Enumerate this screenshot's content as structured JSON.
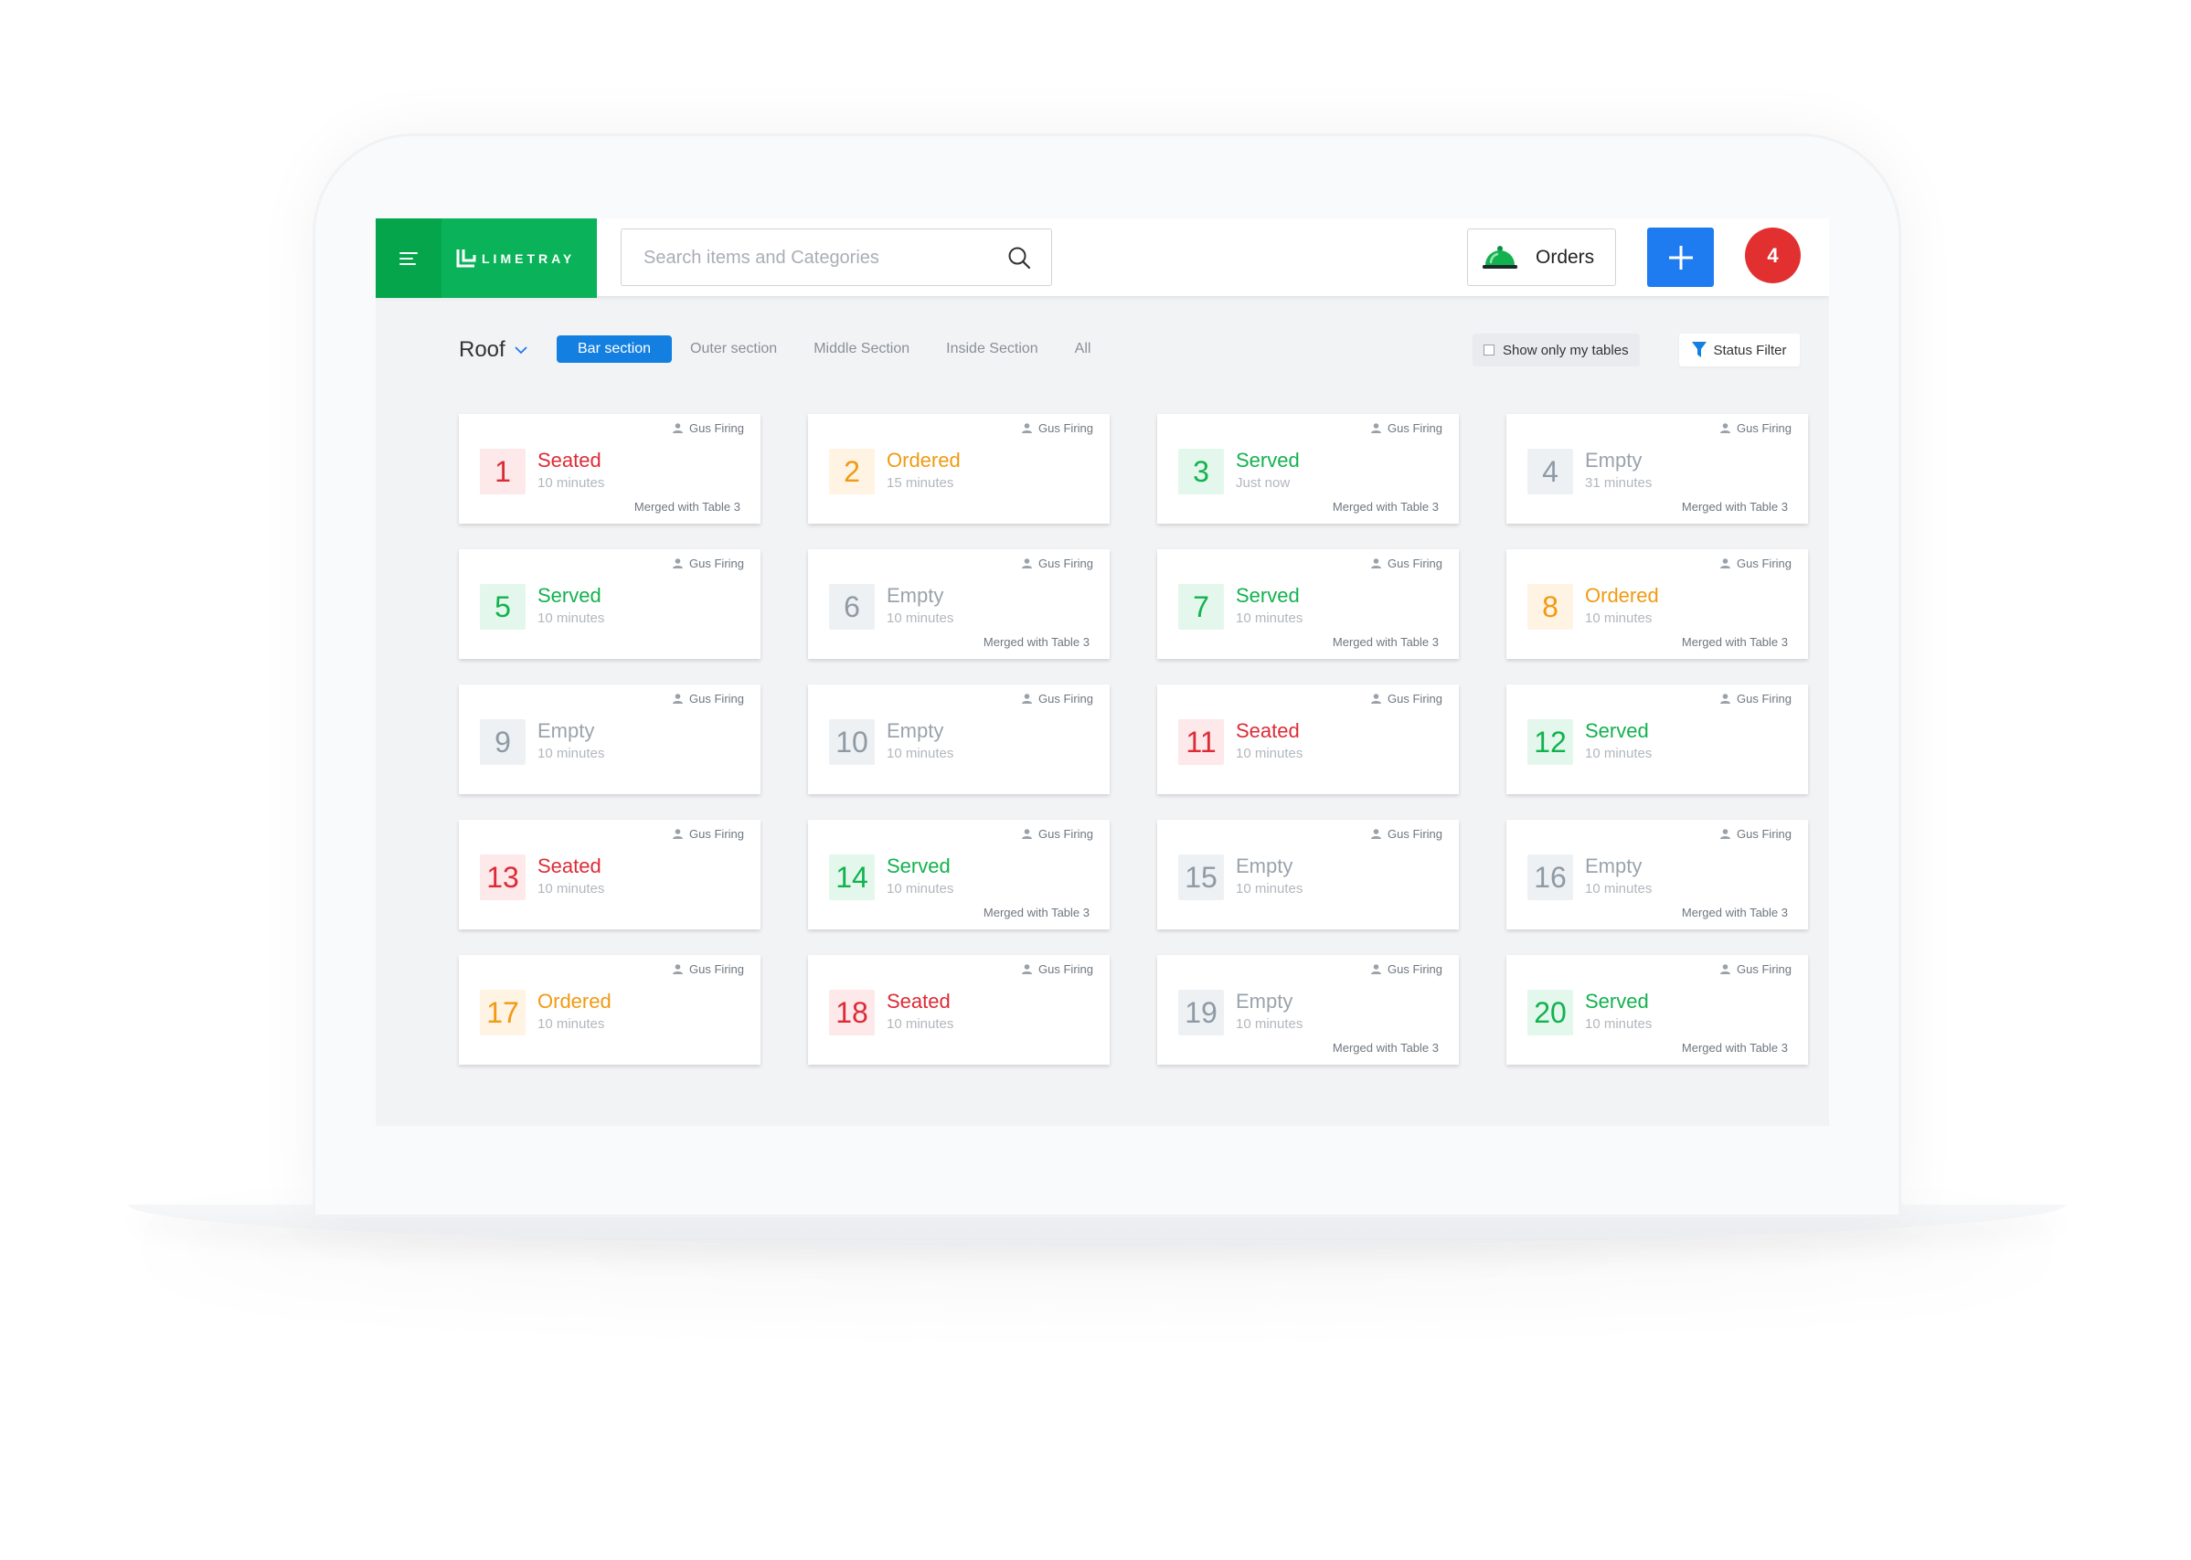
{
  "colors": {
    "brand_green": "#0ab359",
    "primary_blue": "#1f7cf0",
    "badge_red": "#e23030",
    "seated": "#dd2b36",
    "ordered": "#f19a12",
    "served": "#12b24e",
    "empty": "#9aa3ac"
  },
  "header": {
    "menu_icon": "hamburger-menu-icon",
    "logo_text": "LIMETRAY",
    "search_placeholder": "Search items and Categories",
    "search_icon": "search-icon",
    "orders_icon": "serving-bell-icon",
    "orders_label": "Orders",
    "add_icon": "plus-icon",
    "notification_count": "4"
  },
  "filters": {
    "floor": "Roof",
    "tabs": [
      {
        "label": "Bar section",
        "active": true
      },
      {
        "label": "Outer section",
        "active": false
      },
      {
        "label": "Middle Section",
        "active": false
      },
      {
        "label": "Inside Section",
        "active": false
      },
      {
        "label": "All",
        "active": false
      }
    ],
    "only_mine_label": "Show only my tables",
    "only_mine_checked": false,
    "status_filter_label": "Status Filter"
  },
  "tables": [
    {
      "number": "1",
      "status": "Seated",
      "state": "seated",
      "time": "10 minutes",
      "waiter": "Gus Firing",
      "merged": "Merged with Table 3"
    },
    {
      "number": "2",
      "status": "Ordered",
      "state": "ordered",
      "time": "15 minutes",
      "waiter": "Gus Firing",
      "merged": ""
    },
    {
      "number": "3",
      "status": "Served",
      "state": "served",
      "time": "Just now",
      "waiter": "Gus Firing",
      "merged": "Merged with Table 3"
    },
    {
      "number": "4",
      "status": "Empty",
      "state": "empty",
      "time": "31 minutes",
      "waiter": "Gus Firing",
      "merged": "Merged with Table 3"
    },
    {
      "number": "5",
      "status": "Served",
      "state": "served",
      "time": "10 minutes",
      "waiter": "Gus Firing",
      "merged": ""
    },
    {
      "number": "6",
      "status": "Empty",
      "state": "empty",
      "time": "10 minutes",
      "waiter": "Gus Firing",
      "merged": "Merged with Table 3"
    },
    {
      "number": "7",
      "status": "Served",
      "state": "served",
      "time": "10 minutes",
      "waiter": "Gus Firing",
      "merged": "Merged with Table 3"
    },
    {
      "number": "8",
      "status": "Ordered",
      "state": "ordered",
      "time": "10 minutes",
      "waiter": "Gus Firing",
      "merged": "Merged with Table 3"
    },
    {
      "number": "9",
      "status": "Empty",
      "state": "empty",
      "time": "10 minutes",
      "waiter": "Gus Firing",
      "merged": ""
    },
    {
      "number": "10",
      "status": "Empty",
      "state": "empty",
      "time": "10 minutes",
      "waiter": "Gus Firing",
      "merged": ""
    },
    {
      "number": "11",
      "status": "Seated",
      "state": "seated",
      "time": "10 minutes",
      "waiter": "Gus Firing",
      "merged": ""
    },
    {
      "number": "12",
      "status": "Served",
      "state": "served",
      "time": "10 minutes",
      "waiter": "Gus Firing",
      "merged": ""
    },
    {
      "number": "13",
      "status": "Seated",
      "state": "seated",
      "time": "10 minutes",
      "waiter": "Gus Firing",
      "merged": ""
    },
    {
      "number": "14",
      "status": "Served",
      "state": "served",
      "time": "10 minutes",
      "waiter": "Gus Firing",
      "merged": "Merged with Table 3"
    },
    {
      "number": "15",
      "status": "Empty",
      "state": "empty",
      "time": "10 minutes",
      "waiter": "Gus Firing",
      "merged": ""
    },
    {
      "number": "16",
      "status": "Empty",
      "state": "empty",
      "time": "10 minutes",
      "waiter": "Gus Firing",
      "merged": "Merged with Table 3"
    },
    {
      "number": "17",
      "status": "Ordered",
      "state": "ordered",
      "time": "10 minutes",
      "waiter": "Gus Firing",
      "merged": ""
    },
    {
      "number": "18",
      "status": "Seated",
      "state": "seated",
      "time": "10 minutes",
      "waiter": "Gus Firing",
      "merged": ""
    },
    {
      "number": "19",
      "status": "Empty",
      "state": "empty",
      "time": "10 minutes",
      "waiter": "Gus Firing",
      "merged": "Merged with Table 3"
    },
    {
      "number": "20",
      "status": "Served",
      "state": "served",
      "time": "10 minutes",
      "waiter": "Gus Firing",
      "merged": "Merged with Table 3"
    }
  ]
}
